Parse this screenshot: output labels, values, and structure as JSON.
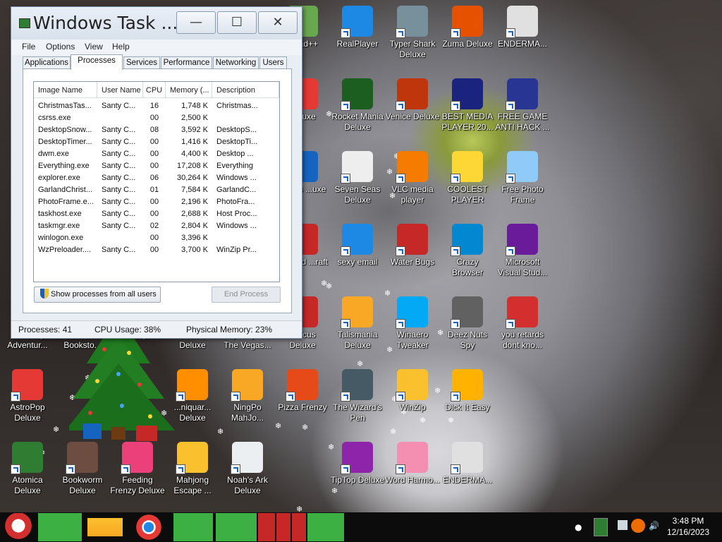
{
  "task_manager": {
    "title": "Windows Task ...",
    "caption_buttons": {
      "minimize": "—",
      "maximize": "☐",
      "close": "✕"
    },
    "menu": [
      "File",
      "Options",
      "View",
      "Help"
    ],
    "tabs": [
      "Applications",
      "Processes",
      "Services",
      "Performance",
      "Networking",
      "Users"
    ],
    "active_tab": "Processes",
    "columns": [
      "Image Name",
      "User Name",
      "CPU",
      "Memory (...",
      "Description"
    ],
    "rows": [
      {
        "image": "ChristmasTas...",
        "user": "Santy C...",
        "cpu": "16",
        "mem": "1,748 K",
        "desc": "Christmas..."
      },
      {
        "image": "csrss.exe",
        "user": "",
        "cpu": "00",
        "mem": "2,500 K",
        "desc": ""
      },
      {
        "image": "DesktopSnow...",
        "user": "Santy C...",
        "cpu": "08",
        "mem": "3,592 K",
        "desc": "DesktopS..."
      },
      {
        "image": "DesktopTimer...",
        "user": "Santy C...",
        "cpu": "00",
        "mem": "1,416 K",
        "desc": "DesktopTi..."
      },
      {
        "image": "dwm.exe",
        "user": "Santy C...",
        "cpu": "00",
        "mem": "4,400 K",
        "desc": "Desktop ..."
      },
      {
        "image": "Everything.exe",
        "user": "Santy C...",
        "cpu": "00",
        "mem": "17,208 K",
        "desc": "Everything"
      },
      {
        "image": "explorer.exe",
        "user": "Santy C...",
        "cpu": "06",
        "mem": "30,264 K",
        "desc": "Windows ..."
      },
      {
        "image": "GarlandChrist...",
        "user": "Santy C...",
        "cpu": "01",
        "mem": "7,584 K",
        "desc": "GarlandC..."
      },
      {
        "image": "PhotoFrame.e...",
        "user": "Santy C...",
        "cpu": "00",
        "mem": "2,196 K",
        "desc": "PhotoFra..."
      },
      {
        "image": "taskhost.exe",
        "user": "Santy C...",
        "cpu": "00",
        "mem": "2,688 K",
        "desc": "Host Proc..."
      },
      {
        "image": "taskmgr.exe",
        "user": "Santy C...",
        "cpu": "02",
        "mem": "2,804 K",
        "desc": "Windows ..."
      },
      {
        "image": "winlogon.exe",
        "user": "",
        "cpu": "00",
        "mem": "3,396 K",
        "desc": ""
      },
      {
        "image": "WzPreloader....",
        "user": "Santy C...",
        "cpu": "00",
        "mem": "3,700 K",
        "desc": "WinZip Pr..."
      }
    ],
    "show_all_label": "Show processes from all users",
    "end_process_label": "End Process",
    "status": {
      "processes": "Processes: 41",
      "cpu": "CPU Usage: 38%",
      "memory": "Physical Memory: 23%"
    }
  },
  "desktop_icons": [
    {
      "label": "...pad++",
      "icon": "notepad-icon",
      "color": "#6aa84f"
    },
    {
      "label": "RealPlayer",
      "icon": "realplayer-icon",
      "color": "#1e88e5"
    },
    {
      "label": "Typer Shark Deluxe",
      "icon": "shark-icon",
      "color": "#78909c"
    },
    {
      "label": "Zuma Deluxe",
      "icon": "zuma-icon",
      "color": "#e65100"
    },
    {
      "label": "ENDERMA...",
      "icon": "window-icon",
      "color": "#e0e0e0"
    },
    {
      "label": "Deluxe",
      "icon": "game-icon",
      "color": "#e53935"
    },
    {
      "label": "Rocket Mania Deluxe",
      "icon": "rocket-icon",
      "color": "#1b5e20"
    },
    {
      "label": "Venice Deluxe",
      "icon": "gondola-icon",
      "color": "#bf360c"
    },
    {
      "label": "BEST MEDIA PLAYER 20...",
      "icon": "xm-player-icon",
      "color": "#1a237e"
    },
    {
      "label": "FREE GAME ANTI HACK ...",
      "icon": "antihack-icon",
      "color": "#283593"
    },
    {
      "label": "Nights ...uxe",
      "icon": "nights-icon",
      "color": "#1565c0"
    },
    {
      "label": "Seven Seas Deluxe",
      "icon": "skull-icon",
      "color": "#eeeeee"
    },
    {
      "label": "VLC media player",
      "icon": "vlc-cone-icon",
      "color": "#f57c00"
    },
    {
      "label": "COOLEST PLAYER",
      "icon": "smiley-icon",
      "color": "#fdd835"
    },
    {
      "label": "Free Photo Frame",
      "icon": "photo-frame-icon",
      "color": "#90caf9"
    },
    {
      "label": "...World ...raft",
      "icon": "world-icon",
      "color": "#c62828"
    },
    {
      "label": "sexy email",
      "icon": "thunderbird-icon",
      "color": "#1e88e5"
    },
    {
      "label": "Water Bugs",
      "icon": "ring-icon",
      "color": "#c62828"
    },
    {
      "label": "Crazy Browser",
      "icon": "star-icon",
      "color": "#0288d1"
    },
    {
      "label": "Microsoft Visual Stud...",
      "icon": "visual-studio-icon",
      "color": "#6a1b9a"
    },
    {
      "label": "Amazing Adventur...",
      "icon": "adventure-icon",
      "color": "#8d6e63"
    },
    {
      "label": "Bookworm Booksto...",
      "icon": "bookworm-icon",
      "color": "#5d4037"
    },
    {
      "label": "...ing",
      "icon": "game-icon",
      "color": "#4e342e"
    },
    {
      "label": "...e Pop Deluxe",
      "icon": "game-icon",
      "color": "#795548"
    },
    {
      "label": "Mystery P... The Vegas...",
      "icon": "game-icon",
      "color": "#6d4c41"
    },
    {
      "label": "...xicus Deluxe",
      "icon": "game-icon",
      "color": "#c62828"
    },
    {
      "label": "Talismania Deluxe",
      "icon": "talisman-icon",
      "color": "#f9a825"
    },
    {
      "label": "Winaero Tweaker",
      "icon": "winaero-icon",
      "color": "#03a9f4"
    },
    {
      "label": "Deez Nuts Spy",
      "icon": "copy-icon",
      "color": "#616161"
    },
    {
      "label": "you retards dont kno...",
      "icon": "dragon-icon",
      "color": "#d32f2f"
    },
    {
      "label": "AstroPop Deluxe",
      "icon": "astropop-icon",
      "color": "#e53935"
    },
    {
      "label": "...niquar... Deluxe",
      "icon": "fish-icon",
      "color": "#ff8f00"
    },
    {
      "label": "NingPo MahJo...",
      "icon": "mahjong-tile-icon",
      "color": "#f9a825"
    },
    {
      "label": "Pizza Frenzy",
      "icon": "pizza-icon",
      "color": "#e64a19"
    },
    {
      "label": "The Wizard's Pen",
      "icon": "wizard-icon",
      "color": "#455a64"
    },
    {
      "label": "WinZip",
      "icon": "winzip-icon",
      "color": "#fbc02d"
    },
    {
      "label": "Dick It Easy",
      "icon": "de-icon",
      "color": "#ffb300"
    },
    {
      "label": "Atomica Deluxe",
      "icon": "atomica-icon",
      "color": "#2e7d32"
    },
    {
      "label": "Bookworm Deluxe",
      "icon": "bookworm-icon",
      "color": "#6d4c41"
    },
    {
      "label": "Feeding Frenzy Deluxe",
      "icon": "fish-icon",
      "color": "#ec407a"
    },
    {
      "label": "Mahjong Escape ...",
      "icon": "mahjong-icon",
      "color": "#fbc02d"
    },
    {
      "label": "Noah's Ark Deluxe",
      "icon": "dove-icon",
      "color": "#eceff1"
    },
    {
      "label": "TipTop Deluxe",
      "icon": "cocktail-icon",
      "color": "#8e24aa"
    },
    {
      "label": "Word Harmo...",
      "icon": "flower-icon",
      "color": "#f48fb1"
    },
    {
      "label": "ENDERMA...",
      "icon": "window-icon",
      "color": "#e0e0e0"
    }
  ],
  "taskbar": {
    "items": [
      "santa-start-icon",
      "firefox-icon",
      "folder-icon",
      "chrome-icon",
      "control-panel-icon",
      "task-manager-icon",
      "tree-app-icon",
      "tree-app-icon",
      "tree-app-icon",
      "task-manager-icon"
    ],
    "clock_time": "3:48 PM",
    "clock_date": "12/16/2023"
  }
}
